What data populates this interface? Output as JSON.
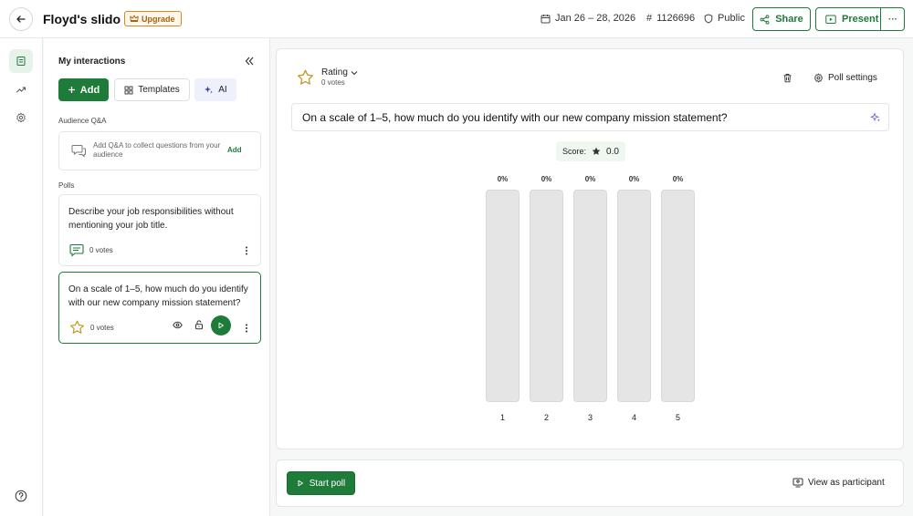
{
  "header": {
    "title": "Floyd's slido",
    "upgrade_label": "Upgrade",
    "date_range": "Jan 26 – 28, 2026",
    "event_code_prefix": "#",
    "event_code": "1126696",
    "visibility": "Public",
    "share_label": "Share",
    "present_label": "Present",
    "more_label": "···"
  },
  "sidebar": {
    "title": "My interactions",
    "add_label": "Add",
    "templates_label": "Templates",
    "ai_label": "AI",
    "qa_section": "Audience Q&A",
    "qa_text": "Add Q&A to collect questions from your audience",
    "qa_add": "Add",
    "polls_section": "Polls",
    "polls": [
      {
        "question": "Describe your job responsibilities without mentioning your job title.",
        "votes": "0 votes",
        "type_icon": "open-text-icon"
      },
      {
        "question": "On a scale of 1–5, how much do you identify with our new company mission statement?",
        "votes": "0 votes",
        "type_icon": "star-icon"
      }
    ]
  },
  "main": {
    "poll_type": "Rating",
    "votes": "0 votes",
    "poll_settings_label": "Poll settings",
    "question": "On a scale of 1–5, how much do you identify with our new company mission statement?",
    "score_label": "Score:",
    "score_value": "0.0"
  },
  "chart_data": {
    "type": "bar",
    "categories": [
      "1",
      "2",
      "3",
      "4",
      "5"
    ],
    "values": [
      0,
      0,
      0,
      0,
      0
    ],
    "value_labels": [
      "0%",
      "0%",
      "0%",
      "0%",
      "0%"
    ],
    "ylim": [
      0,
      100
    ]
  },
  "bottom": {
    "start_label": "Start poll",
    "view_participant_label": "View as participant"
  },
  "colors": {
    "brand": "#1e7b3a",
    "upgrade": "#d08a2a",
    "star": "#c49a22",
    "bar": "#e5e5e5"
  }
}
